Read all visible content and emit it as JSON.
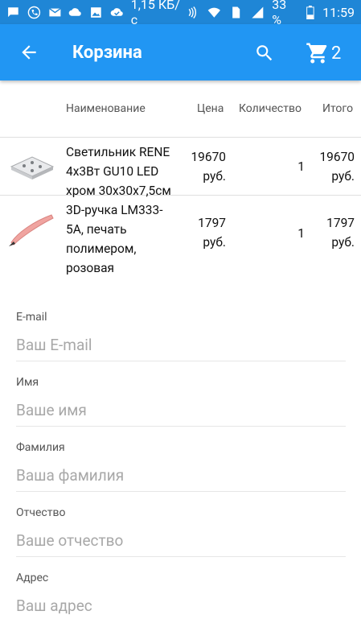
{
  "status_bar": {
    "speed": "1,15 КБ/с",
    "battery": "33 %",
    "time": "11:59"
  },
  "app_bar": {
    "title": "Корзина",
    "cart_count": "2"
  },
  "table": {
    "headers": {
      "name": "Наименование",
      "price": "Цена",
      "qty": "Количество",
      "total": "Итого"
    },
    "rows": [
      {
        "name_lines": [
          "Светильник RENE",
          "4x3Вт GU10 LED",
          "хром 30x30x7,5см"
        ],
        "price_lines": [
          "19670",
          "руб."
        ],
        "qty": "1",
        "total_lines": [
          "19670",
          "руб."
        ]
      },
      {
        "name_lines": [
          "3D-ручка LM333-",
          "5A, печать",
          "полимером,",
          "розовая"
        ],
        "price_lines": [
          "1797",
          "руб."
        ],
        "qty": "1",
        "total_lines": [
          "1797",
          "руб."
        ]
      }
    ]
  },
  "form": {
    "email": {
      "label": "E-mail",
      "placeholder": "Ваш E-mail"
    },
    "first_name": {
      "label": "Имя",
      "placeholder": "Ваше имя"
    },
    "last_name": {
      "label": "Фамилия",
      "placeholder": "Ваша фамилия"
    },
    "patronymic": {
      "label": "Отчество",
      "placeholder": "Ваше отчество"
    },
    "address": {
      "label": "Адрес",
      "placeholder": "Ваш адрес"
    }
  },
  "colors": {
    "status_bar": "#1f86d6",
    "app_bar": "#2196f3",
    "divider": "#e0e0e0"
  },
  "icons": {
    "back": "arrow-left-icon",
    "search": "search-icon",
    "cart": "shopping-cart-icon"
  }
}
